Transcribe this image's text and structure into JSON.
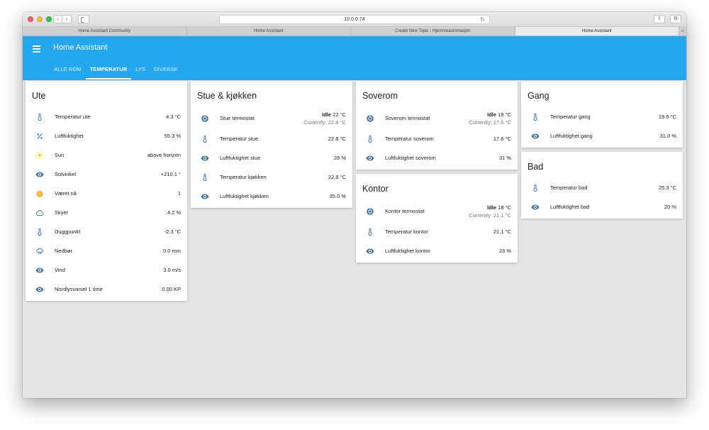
{
  "browser": {
    "url": "10.0.0.74",
    "tabs": [
      {
        "label": "Home Assistant Community"
      },
      {
        "label": "Home Assistant"
      },
      {
        "label": "Create New Topic - Hjemmeautomasjon"
      },
      {
        "label": "Home Assistant"
      }
    ]
  },
  "header": {
    "title": "Home Assistant",
    "tabs": [
      "ALLE ROM",
      "TEMPERATUR",
      "LYS",
      "DIVERSE"
    ],
    "selected_tab": "TEMPERATUR"
  },
  "colors": {
    "accent": "#25a7ef",
    "icon": "#44739e",
    "sun": "#fdd835"
  },
  "cards": {
    "ute": {
      "title": "Ute",
      "rows": [
        {
          "icon": "thermometer-icon",
          "label": "Temperatur ute",
          "value": "4.3 °C"
        },
        {
          "icon": "percent-icon",
          "label": "Luftfuktighet",
          "value": "55.3 %"
        },
        {
          "icon": "sun-icon",
          "label": "Sun",
          "value": "above horizon"
        },
        {
          "icon": "eye-icon",
          "label": "Solvinkel",
          "value": "+210.1 °"
        },
        {
          "icon": "weather-sun-icon",
          "label": "Været nå",
          "value": "1"
        },
        {
          "icon": "cloud-icon",
          "label": "Skyer",
          "value": "4.2 %"
        },
        {
          "icon": "thermometer-icon",
          "label": "Duggpunkt",
          "value": "-2.3 °C"
        },
        {
          "icon": "rain-icon",
          "label": "Nedbør",
          "value": "0.0 mm"
        },
        {
          "icon": "eye-icon",
          "label": "Vind",
          "value": "3.0 m/s"
        },
        {
          "icon": "eye-icon",
          "label": "Nordlysvarsel 1 time",
          "value": "0.00 KP"
        }
      ]
    },
    "stue": {
      "title": "Stue & kjøkken",
      "thermostat": {
        "label": "Stue termostat",
        "state": "Idle",
        "target": "22 °C",
        "current": "Currently: 22.8 °C"
      },
      "rows": [
        {
          "icon": "thermometer-icon",
          "label": "Temperatur stue",
          "value": "22.8 °C"
        },
        {
          "icon": "eye-icon",
          "label": "Luftfuktighet stue",
          "value": "28 %"
        },
        {
          "icon": "thermometer-icon",
          "label": "Temperatur kjøkken",
          "value": "22.8 °C"
        },
        {
          "icon": "eye-icon",
          "label": "Luftfuktighet kjøkken",
          "value": "35.0 %"
        }
      ]
    },
    "soverom": {
      "title": "Soverom",
      "thermostat": {
        "label": "Soverom termostat",
        "state": "Idle",
        "target": "18 °C",
        "current": "Currently: 17.6 °C"
      },
      "rows": [
        {
          "icon": "thermometer-icon",
          "label": "Temperatur soverom",
          "value": "17.6 °C"
        },
        {
          "icon": "eye-icon",
          "label": "Luftfuktighet soverom",
          "value": "31 %"
        }
      ]
    },
    "kontor": {
      "title": "Kontor",
      "thermostat": {
        "label": "Kontor termostat",
        "state": "Idle",
        "target": "18 °C",
        "current": "Currently: 21.1 °C"
      },
      "rows": [
        {
          "icon": "thermometer-icon",
          "label": "Temperatur kontor",
          "value": "21.1 °C"
        },
        {
          "icon": "eye-icon",
          "label": "Luftfuktighet kontor",
          "value": "23 %"
        }
      ]
    },
    "gang": {
      "title": "Gang",
      "rows": [
        {
          "icon": "thermometer-icon",
          "label": "Temperatur gang",
          "value": "19.6 °C"
        },
        {
          "icon": "eye-icon",
          "label": "Luftfuktighet gang",
          "value": "31.0 %"
        }
      ]
    },
    "bad": {
      "title": "Bad",
      "rows": [
        {
          "icon": "thermometer-icon",
          "label": "Temperatur bad",
          "value": "25.3 °C"
        },
        {
          "icon": "eye-icon",
          "label": "Luftfuktighet bad",
          "value": "20 %"
        }
      ]
    }
  }
}
